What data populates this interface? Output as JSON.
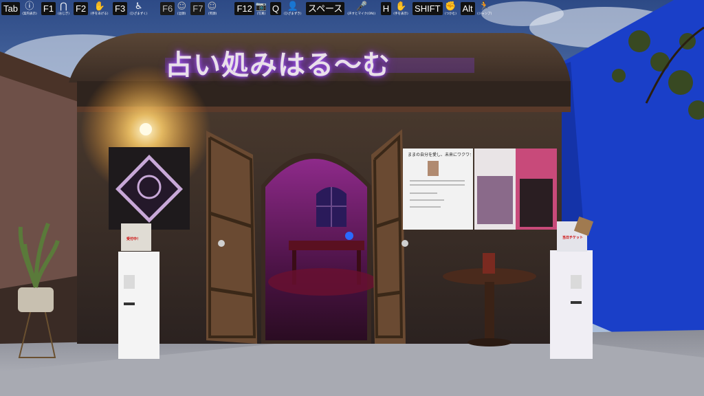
{
  "hud": {
    "items": [
      {
        "key": "Tab",
        "icon": "info-icon",
        "glyph": "ⓘ",
        "caption": "(案内表示)",
        "dim": false
      },
      {
        "key": "F1",
        "icon": "hands-up-icon",
        "glyph": "⋂",
        "caption": "(おじぎ)",
        "dim": false
      },
      {
        "key": "F2",
        "icon": "raise-hand-icon",
        "glyph": "✋",
        "caption": "(手をあげる)",
        "dim": false
      },
      {
        "key": "F3",
        "icon": "sit-icon",
        "glyph": "♿",
        "caption": "(ひざまずく)",
        "dim": false
      },
      {
        "key": "F6",
        "icon": "smile-face-icon",
        "glyph": "☺",
        "caption": "(泣顔)",
        "dim": true
      },
      {
        "key": "F7",
        "icon": "happy-face-icon",
        "glyph": "☺",
        "caption": "(笑顔)",
        "dim": true
      },
      {
        "key": "F12",
        "icon": "camera-icon",
        "glyph": "📷",
        "caption": "(写真)",
        "dim": false
      },
      {
        "key": "Q",
        "icon": "add-user-icon",
        "glyph": "👤",
        "caption": "(ひざまずき)",
        "dim": false
      },
      {
        "key": "スペース",
        "icon": "voice-mic-icon",
        "glyph": "🎤",
        "caption": "(声すとマイク(ON))",
        "dim": false
      },
      {
        "key": "H",
        "icon": "hand-icon",
        "glyph": "✋",
        "caption": "(手を表示)",
        "dim": false
      },
      {
        "key": "SHIFT",
        "icon": "grab-hand-icon",
        "glyph": "✊",
        "caption": "(つかむ)",
        "dim": false
      },
      {
        "key": "Alt",
        "icon": "jump-icon",
        "glyph": "🏃",
        "caption": "(ジャンプ)",
        "dim": false
      }
    ]
  },
  "sign": {
    "title": "占い処みはる〜む"
  },
  "poster": {
    "headline": "ままの自分を愛し、未来にワクワクする"
  },
  "kiosk_left": {
    "label": "受付中！"
  },
  "kiosk_right": {
    "label": "当日チケット"
  }
}
